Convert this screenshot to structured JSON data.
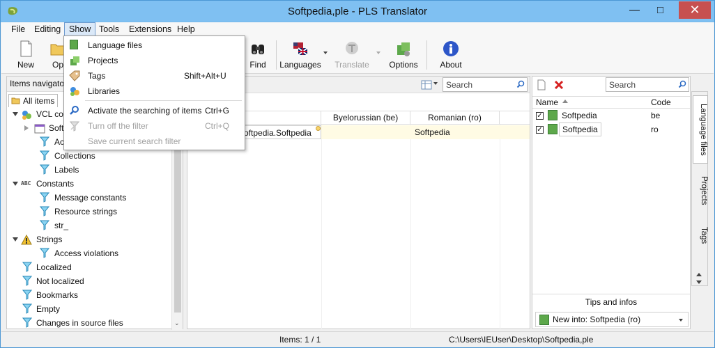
{
  "window": {
    "title": "Softpedia,ple - PLS Translator",
    "minimize": "—",
    "maximize": "□",
    "close": "✕"
  },
  "menu": {
    "items": [
      "File",
      "Editing",
      "Show",
      "Tools",
      "Extensions",
      "Help"
    ],
    "active_item": "Show"
  },
  "toolbar": {
    "new_label": "New",
    "open_label": "Op",
    "find_label": "Find",
    "languages_label": "Languages",
    "translate_label": "Translate",
    "options_label": "Options",
    "about_label": "About"
  },
  "show_menu": {
    "items": [
      {
        "label": "Language files",
        "shortcut": "",
        "disabled": false
      },
      {
        "label": "Projects",
        "shortcut": "",
        "disabled": false
      },
      {
        "label": "Tags",
        "shortcut": "Shift+Alt+U",
        "disabled": false
      },
      {
        "label": "Libraries",
        "shortcut": "",
        "disabled": false
      },
      {
        "label": "Activate the searching of items",
        "shortcut": "Ctrl+G",
        "disabled": false
      },
      {
        "label": "Turn off the filter",
        "shortcut": "Ctrl+Q",
        "disabled": true
      },
      {
        "label": "Save current search filter",
        "shortcut": "",
        "disabled": true
      }
    ]
  },
  "left_panel": {
    "header": "Items navigato",
    "tab": "All items",
    "tree": [
      {
        "text": "VCL com",
        "level": 1
      },
      {
        "text": "Softp",
        "level": 2
      },
      {
        "text": "Actio",
        "level": 2
      },
      {
        "text": "Collections",
        "level": 2
      },
      {
        "text": "Labels",
        "level": 2
      },
      {
        "text": "Constants",
        "level": 1
      },
      {
        "text": "Message constants",
        "level": 2
      },
      {
        "text": "Resource strings",
        "level": 2
      },
      {
        "text": "str_",
        "level": 2
      },
      {
        "text": "Strings",
        "level": 1
      },
      {
        "text": "Access violations",
        "level": 2
      },
      {
        "text": "Localized",
        "level": 1
      },
      {
        "text": "Not localized",
        "level": 1
      },
      {
        "text": "Bookmarks",
        "level": 1
      },
      {
        "text": "Empty",
        "level": 1
      },
      {
        "text": "Changes in source files",
        "level": 1
      }
    ]
  },
  "center_panel": {
    "search_placeholder": "Search",
    "columns": [
      "",
      "Byelorussian (be)",
      "Romanian (ro)"
    ],
    "rows": [
      [
        "oftpedia.Softpedia",
        "",
        "Softpedia"
      ]
    ]
  },
  "right_panel": {
    "search_placeholder": "Search",
    "columns": [
      "Name",
      "Code"
    ],
    "rows": [
      {
        "name": "Softpedia",
        "code": "be",
        "checked": true
      },
      {
        "name": "Softpedia",
        "code": "ro",
        "checked": true
      }
    ],
    "tabs": [
      "Language files",
      "Projects",
      "Tags"
    ],
    "tips_label": "Tips and infos",
    "new_into": "New into: Softpedia (ro)"
  },
  "status": {
    "items": "Items: 1 / 1",
    "path": "C:\\Users\\IEUser\\Desktop\\Softpedia,ple"
  },
  "colors": {
    "titlebar": "#7fc0f2",
    "accent_blue": "#2d6fd6",
    "close_red": "#c75050"
  }
}
